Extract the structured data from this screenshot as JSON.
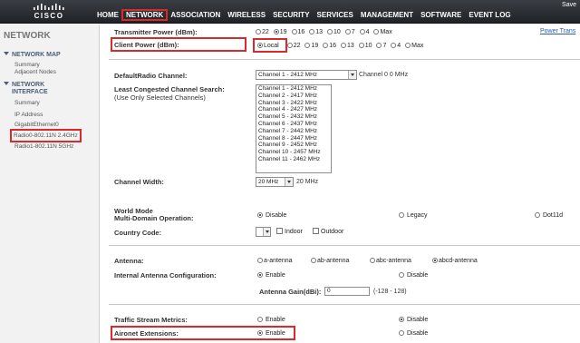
{
  "topbar": {
    "logo_text": "CISCO",
    "right_text": "Save",
    "nav": [
      "HOME",
      "NETWORK",
      "ASSOCIATION",
      "WIRELESS",
      "SECURITY",
      "SERVICES",
      "MANAGEMENT",
      "SOFTWARE",
      "EVENT LOG"
    ],
    "active_nav": "NETWORK"
  },
  "sidebar": {
    "title": "NETWORK",
    "network_map": {
      "label": "NETWORK MAP",
      "items": [
        "Summary",
        "Adjacent Nodes"
      ]
    },
    "network_interface": {
      "label_line1": "NETWORK",
      "label_line2": "INTERFACE",
      "items": [
        "Summary",
        "IP Address",
        "GigabitEthernet0",
        "Radio0-802.11N 2.4GHz",
        "Radio1-802.11N 5GHz"
      ],
      "selected": "Radio0-802.11N 2.4GHz"
    }
  },
  "form": {
    "transmitter_power": {
      "label": "Transmitter Power (dBm):",
      "options": [
        "22",
        "19",
        "16",
        "13",
        "10",
        "7",
        "4",
        "Max"
      ],
      "selected": "19"
    },
    "power_link": "Power Trans",
    "client_power": {
      "label": "Client Power (dBm):",
      "options": [
        "Local",
        "22",
        "19",
        "16",
        "13",
        "10",
        "7",
        "4",
        "Max"
      ],
      "selected": "Local"
    },
    "default_radio_channel": {
      "label": "DefaultRadio Channel:",
      "value": "Channel 1 - 2412 MHz",
      "note": "Channel 0 0 MHz"
    },
    "least_congested": {
      "label_line1": "Least Congested Channel Search:",
      "label_line2": "(Use Only Selected Channels)",
      "channels": [
        "Channel 1 - 2412 MHz",
        "Channel 2 - 2417 MHz",
        "Channel 3 - 2422 MHz",
        "Channel 4 - 2427 MHz",
        "Channel 5 - 2432 MHz",
        "Channel 6 - 2437 MHz",
        "Channel 7 - 2442 MHz",
        "Channel 8 - 2447 MHz",
        "Channel 9 - 2452 MHz",
        "Channel 10 - 2457 MHz",
        "Channel 11 - 2462 MHz"
      ]
    },
    "channel_width": {
      "label": "Channel Width:",
      "value": "20 MHz",
      "note": "20 MHz"
    },
    "world_mode": {
      "label_line1": "World Mode",
      "label_line2": "Multi-Domain Operation:",
      "options": [
        "Disable",
        "Legacy",
        "Dot11d"
      ],
      "selected": "Disable"
    },
    "country_code": {
      "label": "Country Code:",
      "value": "",
      "checkboxes": [
        "Indoor",
        "Outdoor"
      ]
    },
    "antenna": {
      "label": "Antenna:",
      "options": [
        "a-antenna",
        "ab-antenna",
        "abc-antenna",
        "abcd-antenna"
      ],
      "selected": "abcd-antenna"
    },
    "internal_antenna": {
      "label": "Internal Antenna Configuration:",
      "options": [
        "Enable",
        "Disable"
      ],
      "selected": "Enable"
    },
    "antenna_gain": {
      "label": "Antenna Gain(dBi):",
      "value": "0",
      "range": "(-128 - 128)"
    },
    "traffic_stream": {
      "label": "Traffic Stream Metrics:",
      "options": [
        "Enable",
        "Disable"
      ],
      "selected": "Disable"
    },
    "aironet": {
      "label": "Aironet Extensions:",
      "options": [
        "Enable",
        "Disable"
      ],
      "selected": "Enable"
    }
  }
}
